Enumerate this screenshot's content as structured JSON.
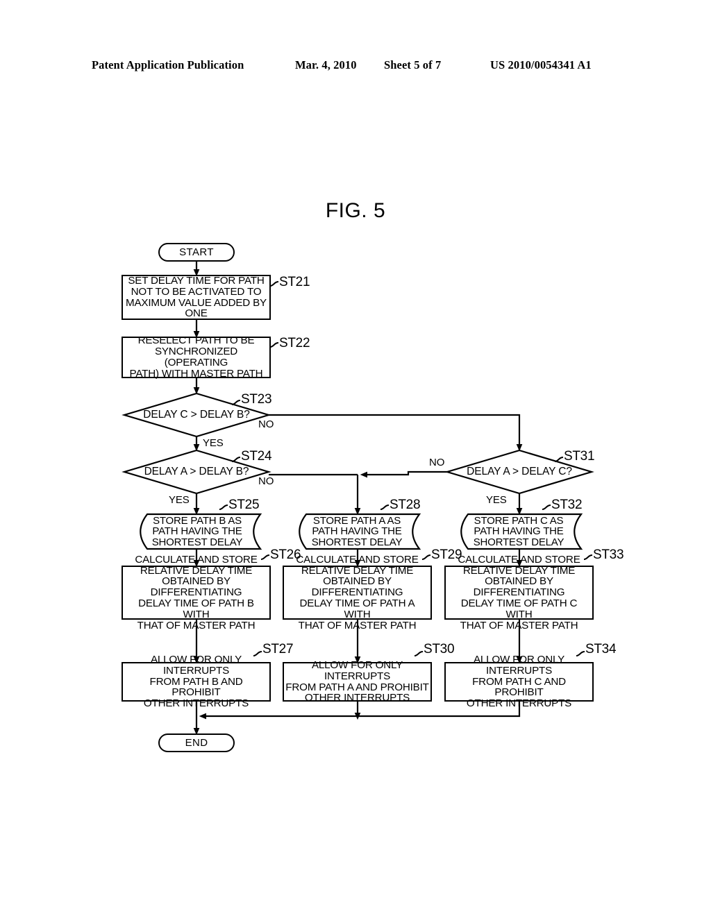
{
  "header": {
    "publication": "Patent Application Publication",
    "date": "Mar. 4, 2010",
    "sheet": "Sheet 5 of 7",
    "number": "US 2010/0054341 A1"
  },
  "figure": {
    "title": "FIG. 5"
  },
  "flowchart": {
    "nodes": {
      "start": {
        "label": "START"
      },
      "end": {
        "label": "END"
      },
      "st21": {
        "ref": "ST21",
        "text": "SET DELAY TIME FOR PATH\nNOT TO BE ACTIVATED TO\nMAXIMUM VALUE ADDED BY ONE"
      },
      "st22": {
        "ref": "ST22",
        "text": "RESELECT PATH TO BE\nSYNCHRONIZED (OPERATING\nPATH) WITH MASTER PATH"
      },
      "st23": {
        "ref": "ST23",
        "text": "DELAY C > DELAY B?"
      },
      "st24": {
        "ref": "ST24",
        "text": "DELAY A > DELAY B?"
      },
      "st31": {
        "ref": "ST31",
        "text": "DELAY A > DELAY C?"
      },
      "st25": {
        "ref": "ST25",
        "text": "STORE PATH B AS\nPATH HAVING THE\nSHORTEST DELAY"
      },
      "st28": {
        "ref": "ST28",
        "text": "STORE PATH A AS\nPATH HAVING THE\nSHORTEST DELAY"
      },
      "st32": {
        "ref": "ST32",
        "text": "STORE PATH C AS\nPATH HAVING THE\nSHORTEST DELAY"
      },
      "st26": {
        "ref": "ST26",
        "text": "CALCULATE AND STORE\nRELATIVE DELAY TIME\nOBTAINED BY DIFFERENTIATING\nDELAY TIME OF PATH B WITH\nTHAT OF MASTER PATH"
      },
      "st29": {
        "ref": "ST29",
        "text": "CALCULATE AND STORE\nRELATIVE DELAY TIME\nOBTAINED BY DIFFERENTIATING\nDELAY TIME OF PATH A WITH\nTHAT OF MASTER PATH"
      },
      "st33": {
        "ref": "ST33",
        "text": "CALCULATE AND STORE\nRELATIVE DELAY TIME\nOBTAINED BY DIFFERENTIATING\nDELAY TIME OF PATH C WITH\nTHAT OF MASTER PATH"
      },
      "st27": {
        "ref": "ST27",
        "text": "ALLOW FOR ONLY INTERRUPTS\nFROM PATH B AND PROHIBIT\nOTHER INTERRUPTS"
      },
      "st30": {
        "ref": "ST30",
        "text": "ALLOW FOR ONLY INTERRUPTS\nFROM PATH A AND PROHIBIT\nOTHER INTERRUPTS"
      },
      "st34": {
        "ref": "ST34",
        "text": "ALLOW FOR ONLY INTERRUPTS\nFROM PATH C AND PROHIBIT\nOTHER INTERRUPTS"
      }
    },
    "edge_labels": {
      "st23_no": "NO",
      "st23_yes": "YES",
      "st24_no": "NO",
      "st24_yes": "YES",
      "st31_no": "NO",
      "st31_yes": "YES"
    }
  },
  "colors": {
    "ink": "#000000",
    "paper": "#ffffff"
  }
}
